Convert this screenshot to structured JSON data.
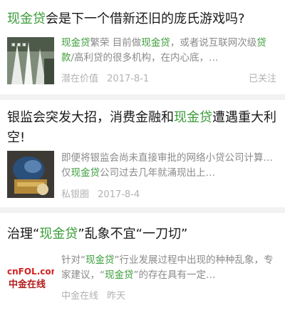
{
  "articles": [
    {
      "title_parts": [
        {
          "text": "现金贷",
          "hl": true
        },
        {
          "text": "会是下一个借新还旧的庞氏游戏吗?",
          "hl": false
        }
      ],
      "snippet_parts": [
        {
          "text": "现金贷",
          "hl": true
        },
        {
          "text": "繁荣 目前做",
          "hl": false
        },
        {
          "text": "现金贷",
          "hl": true
        },
        {
          "text": "，或者说互联网次级",
          "hl": false
        },
        {
          "text": "贷款",
          "hl": true
        },
        {
          "text": "/高利贷的很多机构，在内心底，…",
          "hl": false
        }
      ],
      "source": "潜在价值",
      "date": "2017-8-1",
      "follow": "已关注"
    },
    {
      "title_parts": [
        {
          "text": "银监会突发大招，消费金融和",
          "hl": false
        },
        {
          "text": "现金贷",
          "hl": true
        },
        {
          "text": "遭遇重大利空!",
          "hl": false
        }
      ],
      "snippet_parts": [
        {
          "text": "即便将银监会尚未直接审批的网络小贷公司计算…仅",
          "hl": false
        },
        {
          "text": "现金贷",
          "hl": true
        },
        {
          "text": "公司过去几年就涌现出上…",
          "hl": false
        }
      ],
      "source": "私银圈",
      "date": "2017-8-4"
    },
    {
      "title_parts": [
        {
          "text": "治理“",
          "hl": false
        },
        {
          "text": "现金贷",
          "hl": true
        },
        {
          "text": "”乱象不宜“一刀切”",
          "hl": false
        }
      ],
      "snippet_parts": [
        {
          "text": "针对“",
          "hl": false
        },
        {
          "text": "现金贷",
          "hl": true
        },
        {
          "text": "”行业发展过程中出现的种种乱象，专家建议，“",
          "hl": false
        },
        {
          "text": "现金贷",
          "hl": true
        },
        {
          "text": "”的存在具有一定…",
          "hl": false
        }
      ],
      "source": "中金在线",
      "date": "昨天",
      "logo_text": "cnFOL.com",
      "logo_sub": "中金在线"
    }
  ],
  "colors": {
    "highlight": "#3a9c3a",
    "meta": "#b2b2b2",
    "snippet": "#8a8a8a"
  }
}
